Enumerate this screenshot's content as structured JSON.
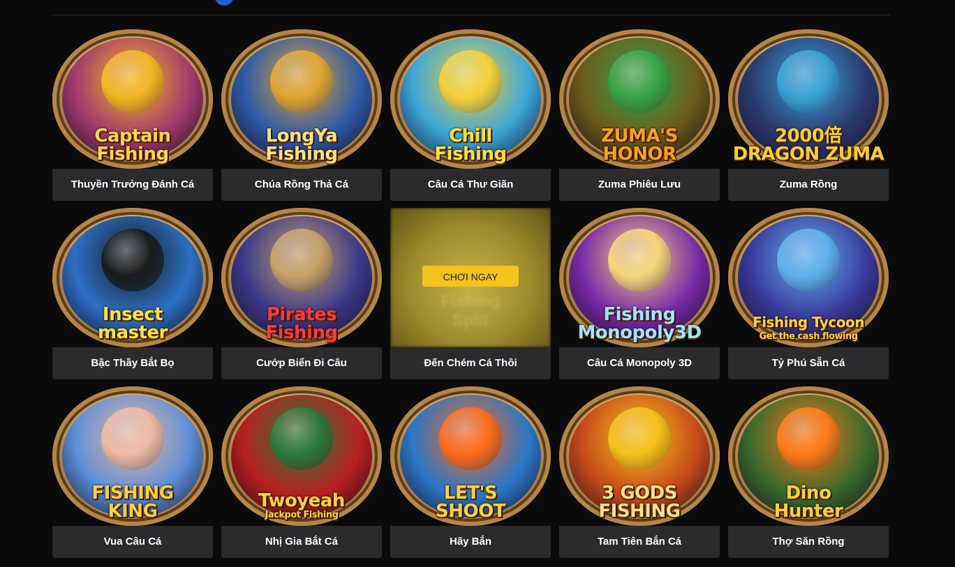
{
  "play_now_label": "CHƠI NGAY",
  "games": [
    {
      "title": "Thuyền Trưởng Đánh Cá",
      "logo1": "Captain",
      "logo2": "Fishing",
      "bg": "#a23a6e",
      "accent": "#f4b722",
      "fg": "#ffd54a"
    },
    {
      "title": "Chúa Rồng Thả Cá",
      "logo1": "LongYa",
      "logo2": "Fishing",
      "bg": "#2d5aa8",
      "accent": "#e2a632",
      "fg": "#ffe27a"
    },
    {
      "title": "Câu Cá Thư Giãn",
      "logo1": "Chill",
      "logo2": "Fishing",
      "bg": "#3aa6d8",
      "accent": "#f6d13a",
      "fg": "#ffe03a"
    },
    {
      "title": "Zuma Phiêu Lưu",
      "logo1": "ZUMA'S",
      "logo2": "HONOR",
      "bg": "#6b5a1a",
      "accent": "#38a54a",
      "fg": "#ff9e1f"
    },
    {
      "title": "Zuma Rồng",
      "logo1": "2000倍",
      "logo2": "DRAGON ZUMA",
      "bg": "#2a3a6e",
      "accent": "#3aa3d8",
      "fg": "#ffcc33"
    },
    {
      "title": "Bậc Thầy Bắt Bọ",
      "logo1": "Insect",
      "logo2": "master",
      "bg": "#2b6fc4",
      "accent": "#1b1b1b",
      "fg": "#ffe23a"
    },
    {
      "title": "Cướp Biển Đi Câu",
      "logo1": "Pirates",
      "logo2": "Fishing",
      "bg": "#3b3a8a",
      "accent": "#c9a36a",
      "fg": "#ff3a3a"
    },
    {
      "title": "Đến Chém Cá Thôi",
      "logo1": "Fishing",
      "logo2": "Split",
      "bg": "#b8a23a",
      "accent": "#f3c21b",
      "fg": "#e8d87a",
      "hover": true
    },
    {
      "title": "Câu Cá Monopoly 3D",
      "logo1": "Fishing",
      "logo2": "Monopoly3D",
      "bg": "#7a2aa8",
      "accent": "#f6d77a",
      "fg": "#9fe3ff"
    },
    {
      "title": "Tỷ Phú Sẵn Cá",
      "logo1": "Fishing Tycoon",
      "logo2": "Get the cash flowing",
      "bg": "#3a3a9a",
      "accent": "#5fb3f0",
      "fg": "#ffd23a"
    },
    {
      "title": "Vua Câu Cá",
      "logo1": "FISHING",
      "logo2": "KING",
      "bg": "#5a8ed8",
      "accent": "#f0b8a0",
      "fg": "#ffcf3a"
    },
    {
      "title": "Nhị Gia Bắt Cá",
      "logo1": "Twoyeah",
      "logo2": "Jackpot Fishing",
      "bg": "#b82020",
      "accent": "#2a7a3a",
      "fg": "#ffd23a"
    },
    {
      "title": "Hãy Bắn",
      "logo1": "LET'S",
      "logo2": "SHOOT",
      "bg": "#2a78c8",
      "accent": "#ff6a1a",
      "fg": "#ffd23a"
    },
    {
      "title": "Tam Tiên Bắn Cá",
      "logo1": "3 GODS",
      "logo2": "FISHING",
      "bg": "#c84a1a",
      "accent": "#f3c21b",
      "fg": "#ffe08a"
    },
    {
      "title": "Thợ Săn Rồng",
      "logo1": "Dino",
      "logo2": "Hunter",
      "bg": "#3a6a2a",
      "accent": "#ff7a1a",
      "fg": "#ffcf3a"
    }
  ]
}
